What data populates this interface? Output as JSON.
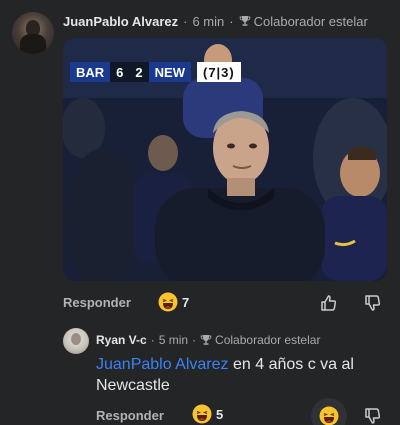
{
  "comment1": {
    "username": "JuanPablo Alvarez",
    "time": "6 min",
    "badge": "Colaborador estelar",
    "scoreboard": {
      "home_team": "BAR",
      "home_score": "6",
      "away_score": "2",
      "away_team": "NEW",
      "aggregate": "(7|3)"
    },
    "reply_label": "Responder",
    "reaction_count": "7"
  },
  "comment2": {
    "username": "Ryan V-c",
    "time": "5 min",
    "badge": "Colaborador estelar",
    "mention": "JuanPablo Alvarez",
    "text": " en 4 años c va al Newcastle",
    "reply_label": "Responder",
    "reaction_count": "5"
  },
  "colors": {
    "background": "#242526",
    "mention": "#3b82f6",
    "score_team_bg": "#1b3a8f",
    "text": "#e4e6eb",
    "muted": "#a8abaf"
  },
  "icons": [
    "trophy-icon",
    "laughing-emoji-icon",
    "thumbs-up-icon",
    "thumbs-down-icon"
  ]
}
